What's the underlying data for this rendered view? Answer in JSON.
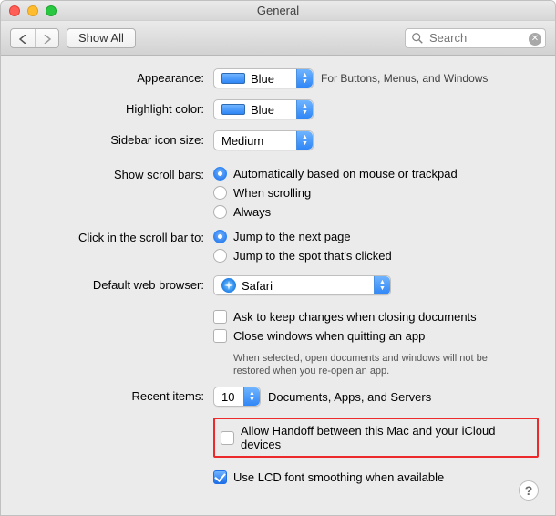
{
  "window": {
    "title": "General"
  },
  "toolbar": {
    "showAll": "Show All"
  },
  "search": {
    "placeholder": "Search"
  },
  "appearance": {
    "label": "Appearance:",
    "value": "Blue",
    "hint": "For Buttons, Menus, and Windows"
  },
  "highlight": {
    "label": "Highlight color:",
    "value": "Blue"
  },
  "sidebar": {
    "label": "Sidebar icon size:",
    "value": "Medium"
  },
  "scrollbars": {
    "label": "Show scroll bars:",
    "opt1": "Automatically based on mouse or trackpad",
    "opt2": "When scrolling",
    "opt3": "Always"
  },
  "scrollclick": {
    "label": "Click in the scroll bar to:",
    "opt1": "Jump to the next page",
    "opt2": "Jump to the spot that's clicked"
  },
  "browser": {
    "label": "Default web browser:",
    "value": "Safari"
  },
  "docs": {
    "askKeep": "Ask to keep changes when closing documents",
    "closeWin": "Close windows when quitting an app",
    "closeNote": "When selected, open documents and windows will not be restored when you re-open an app."
  },
  "recent": {
    "label": "Recent items:",
    "value": "10",
    "hint": "Documents, Apps, and Servers"
  },
  "handoff": {
    "label": "Allow Handoff between this Mac and your iCloud devices"
  },
  "lcd": {
    "label": "Use LCD font smoothing when available"
  }
}
